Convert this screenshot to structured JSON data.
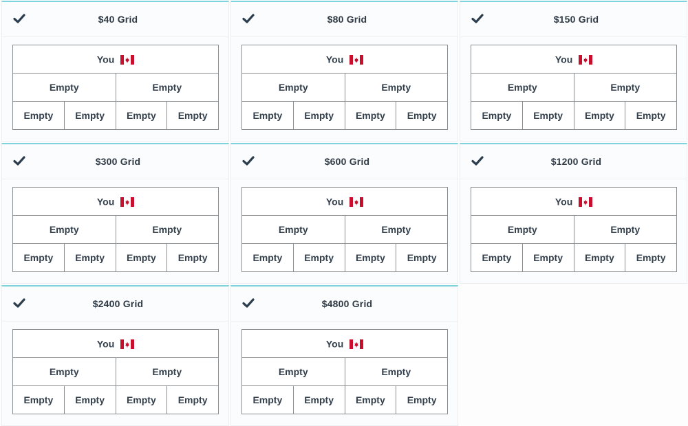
{
  "colors": {
    "accent_top_border": "#7fd3dc",
    "text": "#2f3a45",
    "flag_red": "#c8102e"
  },
  "grids": [
    {
      "title": "$40 Grid",
      "selected": true,
      "top": "You",
      "top_flag": "canada-flag",
      "row2": [
        "Empty",
        "Empty"
      ],
      "row3": [
        "Empty",
        "Empty",
        "Empty",
        "Empty"
      ]
    },
    {
      "title": "$80 Grid",
      "selected": true,
      "top": "You",
      "top_flag": "canada-flag",
      "row2": [
        "Empty",
        "Empty"
      ],
      "row3": [
        "Empty",
        "Empty",
        "Empty",
        "Empty"
      ]
    },
    {
      "title": "$150 Grid",
      "selected": true,
      "top": "You",
      "top_flag": "canada-flag",
      "row2": [
        "Empty",
        "Empty"
      ],
      "row3": [
        "Empty",
        "Empty",
        "Empty",
        "Empty"
      ]
    },
    {
      "title": "$300 Grid",
      "selected": true,
      "top": "You",
      "top_flag": "canada-flag",
      "row2": [
        "Empty",
        "Empty"
      ],
      "row3": [
        "Empty",
        "Empty",
        "Empty",
        "Empty"
      ]
    },
    {
      "title": "$600 Grid",
      "selected": true,
      "top": "You",
      "top_flag": "canada-flag",
      "row2": [
        "Empty",
        "Empty"
      ],
      "row3": [
        "Empty",
        "Empty",
        "Empty",
        "Empty"
      ]
    },
    {
      "title": "$1200 Grid",
      "selected": true,
      "top": "You",
      "top_flag": "canada-flag",
      "row2": [
        "Empty",
        "Empty"
      ],
      "row3": [
        "Empty",
        "Empty",
        "Empty",
        "Empty"
      ]
    },
    {
      "title": "$2400 Grid",
      "selected": true,
      "top": "You",
      "top_flag": "canada-flag",
      "row2": [
        "Empty",
        "Empty"
      ],
      "row3": [
        "Empty",
        "Empty",
        "Empty",
        "Empty"
      ]
    },
    {
      "title": "$4800 Grid",
      "selected": true,
      "top": "You",
      "top_flag": "canada-flag",
      "row2": [
        "Empty",
        "Empty"
      ],
      "row3": [
        "Empty",
        "Empty",
        "Empty",
        "Empty"
      ]
    }
  ]
}
